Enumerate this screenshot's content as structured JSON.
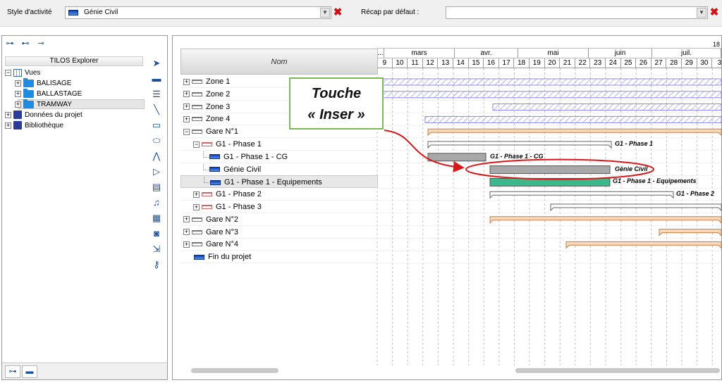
{
  "toolbar": {
    "style_label": "Style d'activité",
    "style_value": "Génie Civil",
    "recap_label": "Récap par défaut :",
    "recap_value": ""
  },
  "explorer": {
    "title": "TILOS Explorer",
    "tree": {
      "vues": "Vues",
      "balisage": "BALISAGE",
      "ballastage": "BALLASTAGE",
      "tramway": "TRAMWAY",
      "donnees": "Données du projet",
      "bibliotheque": "Bibliothèque"
    }
  },
  "gantt": {
    "column_header": "Nom",
    "rows": [
      {
        "label": "Zone 1"
      },
      {
        "label": "Zone 2"
      },
      {
        "label": "Zone 3"
      },
      {
        "label": "Zone 4"
      },
      {
        "label": "Gare N°1"
      },
      {
        "label": "G1 - Phase 1"
      },
      {
        "label": "G1 - Phase 1 - CG"
      },
      {
        "label": "Génie Civil"
      },
      {
        "label": "G1 - Phase 1 - Equipements"
      },
      {
        "label": "G1 - Phase 2"
      },
      {
        "label": "G1 - Phase 3"
      },
      {
        "label": "Gare N°2"
      },
      {
        "label": "Gare N°3"
      },
      {
        "label": "Gare N°4"
      },
      {
        "label": "Fin du projet"
      }
    ],
    "timeline": {
      "top_label": "18",
      "months": [
        "...",
        "mars",
        "avr.",
        "mai",
        "juin",
        "juil."
      ],
      "weeks": [
        "9",
        "10",
        "11",
        "12",
        "13",
        "14",
        "15",
        "16",
        "17",
        "18",
        "19",
        "20",
        "21",
        "22",
        "23",
        "24",
        "25",
        "26",
        "27",
        "28",
        "29",
        "30",
        "3"
      ]
    },
    "bar_labels": {
      "phase1": "G1 - Phase 1",
      "cg": "G1 - Phase 1 - CG",
      "genie_civil": "Génie Civil",
      "equipements": "G1 - Phase 1 - Equipements",
      "phase2": "G1 - Phase 2"
    },
    "colors": {
      "hatch": "#8888ee",
      "gare_bar": "#fbd9b8",
      "gare_border": "#c08050",
      "grey_bar": "#a8a8a8",
      "green_bar": "#3cb88c",
      "annotation_red": "#d81818"
    }
  },
  "callout": {
    "line1": "Touche",
    "line2": "« Inser »"
  }
}
